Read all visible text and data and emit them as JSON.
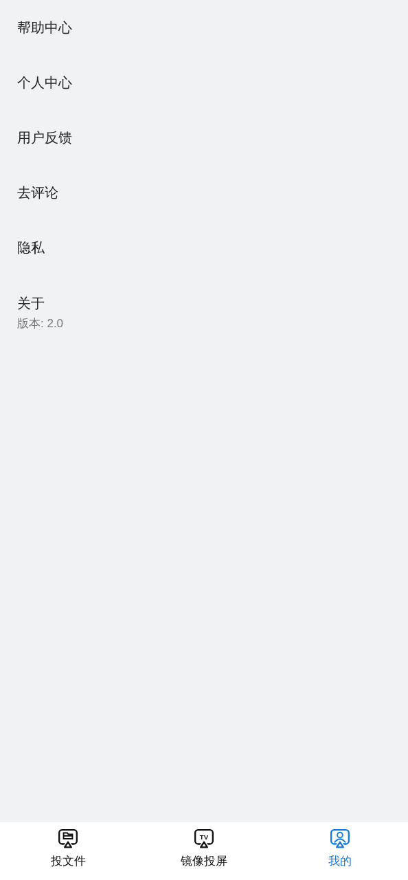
{
  "menu_items": [
    {
      "label": "帮助中心"
    },
    {
      "label": "个人中心"
    },
    {
      "label": "用户反馈"
    },
    {
      "label": "去评论"
    },
    {
      "label": "隐私"
    },
    {
      "label": "关于",
      "subtitle": "版本: 2.0"
    }
  ],
  "bottom_nav": [
    {
      "label": "投文件",
      "kind": "file",
      "selected": false
    },
    {
      "label": "镜像投屏",
      "kind": "tv",
      "icon_text": "TV",
      "selected": false
    },
    {
      "label": "我的",
      "kind": "user",
      "selected": true
    }
  ]
}
